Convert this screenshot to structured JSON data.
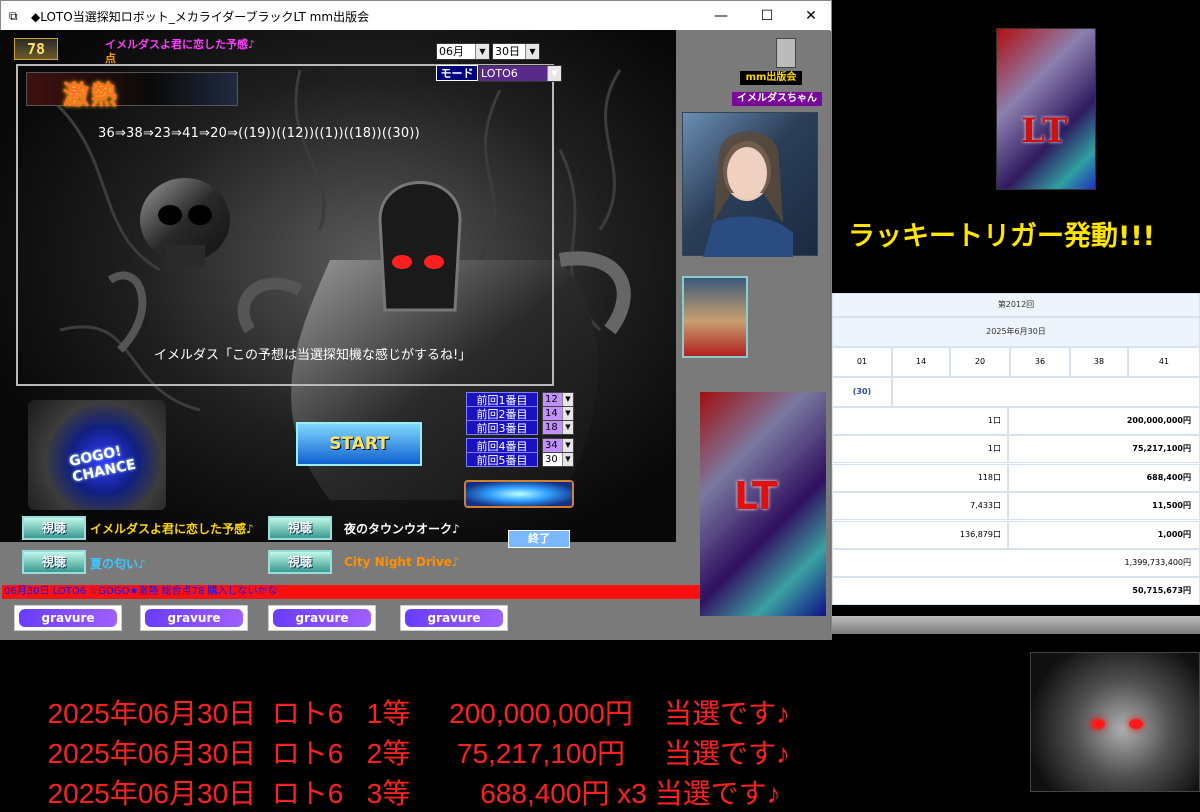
{
  "window": {
    "title": "◆LOTO当選探知ロボット_メカライダーブラックLT  mm出版会",
    "minimize": "—",
    "maximize": "☐",
    "close": "✕"
  },
  "header": {
    "badge": "78",
    "song_title": "イメルダスよ君に恋した予感♪",
    "score_label": "点",
    "month_value": "06月",
    "day_value": "30日",
    "mode_label": "モード",
    "mode_value": "LOTO6"
  },
  "banner": {
    "text": "激熱"
  },
  "sequence_text": "36⇒38⇒23⇒41⇒20⇒((19))((12))((1))((18))((30))",
  "speech_text": "イメルダス「この予想は当選探知機な感じがするね!」",
  "gogo_text": "GOGO! CHANCE",
  "start_label": "START",
  "previous": [
    {
      "label": "前回1番目",
      "value": "12"
    },
    {
      "label": "前回2番目",
      "value": "14"
    },
    {
      "label": "前回3番目",
      "value": "18"
    },
    {
      "label": "前回4番目",
      "value": "34"
    },
    {
      "label": "前回5番目",
      "value": "30"
    }
  ],
  "songs": [
    {
      "button": "視聴",
      "title": "イメルダスよ君に恋した予感♪",
      "color": "#ffd800"
    },
    {
      "button": "視聴",
      "title": "夜のタウンウオーク♪",
      "color": "#ffffff"
    },
    {
      "button": "視聴",
      "title": "夏の匂い♪",
      "color": "#3cc8ff"
    },
    {
      "button": "視聴",
      "title": "City Night Drive♪",
      "color": "#ff9000"
    }
  ],
  "end_label": "終了",
  "status_text": "06月30日 LOTO6 ☆GOGO★激熱 総合点78  購入しないかな",
  "gravure_label": "gravure",
  "side": {
    "mm_label": "mm出版会",
    "char_label": "イメルダスちゃん",
    "slot_text": "LT"
  },
  "right": {
    "lt_text": "LT",
    "lucky_text": "ラッキートリガー発動!!!"
  },
  "result_table": {
    "round": "第2012回",
    "date": "2025年6月30日",
    "numbers": [
      "01",
      "14",
      "20",
      "36",
      "38",
      "41"
    ],
    "bonus": "(30)",
    "rows": [
      {
        "count": "1口",
        "amount": "200,000,000円"
      },
      {
        "count": "1口",
        "amount": "75,217,100円"
      },
      {
        "count": "118口",
        "amount": "688,400円"
      },
      {
        "count": "7,433口",
        "amount": "11,500円"
      },
      {
        "count": "136,879口",
        "amount": "1,000円"
      }
    ],
    "sales": "1,399,733,400円",
    "carryover": "50,715,673円"
  },
  "win_lines": [
    {
      "date": "2025年06月30日",
      "game": "ロト6",
      "rank": "1等",
      "amount": "200,000,000円",
      "note": "当選です♪"
    },
    {
      "date": "2025年06月30日",
      "game": "ロト6",
      "rank": "2等",
      "amount": "75,217,100円",
      "note": "当選です♪"
    },
    {
      "date": "2025年06月30日",
      "game": "ロト6",
      "rank": "3等",
      "amount": "688,400円 x3",
      "note": "当選です♪"
    }
  ]
}
